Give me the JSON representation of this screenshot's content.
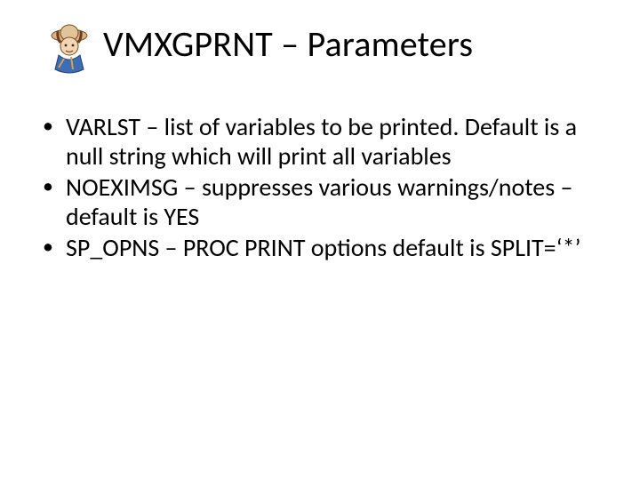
{
  "title": "VMXGPRNT – Parameters",
  "bullets": [
    "VARLST – list of variables to be printed. Default is a null string which will print all variables",
    "NOEXIMSG – suppresses various warnings/notes – default is YES",
    "SP_OPNS – PROC PRINT options default is SPLIT=‘*’"
  ]
}
